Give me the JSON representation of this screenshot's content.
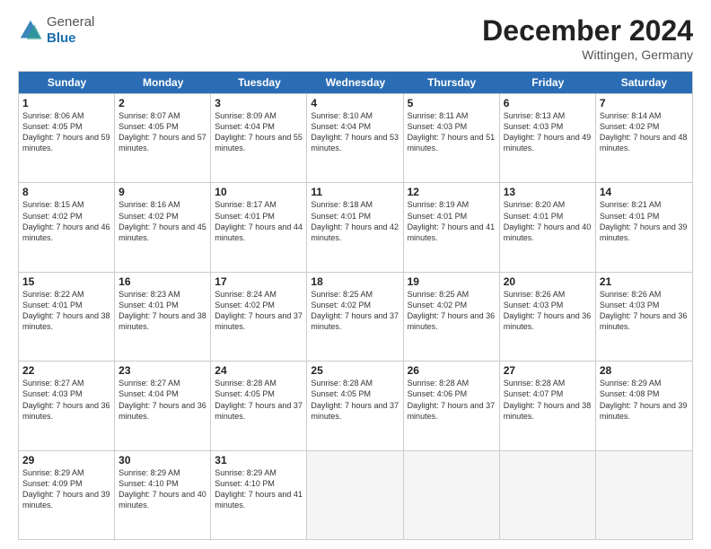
{
  "header": {
    "logo_general": "General",
    "logo_blue": "Blue",
    "month_year": "December 2024",
    "location": "Wittingen, Germany"
  },
  "weekdays": [
    "Sunday",
    "Monday",
    "Tuesday",
    "Wednesday",
    "Thursday",
    "Friday",
    "Saturday"
  ],
  "rows": [
    [
      {
        "day": "1",
        "sunrise": "Sunrise: 8:06 AM",
        "sunset": "Sunset: 4:05 PM",
        "daylight": "Daylight: 7 hours and 59 minutes."
      },
      {
        "day": "2",
        "sunrise": "Sunrise: 8:07 AM",
        "sunset": "Sunset: 4:05 PM",
        "daylight": "Daylight: 7 hours and 57 minutes."
      },
      {
        "day": "3",
        "sunrise": "Sunrise: 8:09 AM",
        "sunset": "Sunset: 4:04 PM",
        "daylight": "Daylight: 7 hours and 55 minutes."
      },
      {
        "day": "4",
        "sunrise": "Sunrise: 8:10 AM",
        "sunset": "Sunset: 4:04 PM",
        "daylight": "Daylight: 7 hours and 53 minutes."
      },
      {
        "day": "5",
        "sunrise": "Sunrise: 8:11 AM",
        "sunset": "Sunset: 4:03 PM",
        "daylight": "Daylight: 7 hours and 51 minutes."
      },
      {
        "day": "6",
        "sunrise": "Sunrise: 8:13 AM",
        "sunset": "Sunset: 4:03 PM",
        "daylight": "Daylight: 7 hours and 49 minutes."
      },
      {
        "day": "7",
        "sunrise": "Sunrise: 8:14 AM",
        "sunset": "Sunset: 4:02 PM",
        "daylight": "Daylight: 7 hours and 48 minutes."
      }
    ],
    [
      {
        "day": "8",
        "sunrise": "Sunrise: 8:15 AM",
        "sunset": "Sunset: 4:02 PM",
        "daylight": "Daylight: 7 hours and 46 minutes."
      },
      {
        "day": "9",
        "sunrise": "Sunrise: 8:16 AM",
        "sunset": "Sunset: 4:02 PM",
        "daylight": "Daylight: 7 hours and 45 minutes."
      },
      {
        "day": "10",
        "sunrise": "Sunrise: 8:17 AM",
        "sunset": "Sunset: 4:01 PM",
        "daylight": "Daylight: 7 hours and 44 minutes."
      },
      {
        "day": "11",
        "sunrise": "Sunrise: 8:18 AM",
        "sunset": "Sunset: 4:01 PM",
        "daylight": "Daylight: 7 hours and 42 minutes."
      },
      {
        "day": "12",
        "sunrise": "Sunrise: 8:19 AM",
        "sunset": "Sunset: 4:01 PM",
        "daylight": "Daylight: 7 hours and 41 minutes."
      },
      {
        "day": "13",
        "sunrise": "Sunrise: 8:20 AM",
        "sunset": "Sunset: 4:01 PM",
        "daylight": "Daylight: 7 hours and 40 minutes."
      },
      {
        "day": "14",
        "sunrise": "Sunrise: 8:21 AM",
        "sunset": "Sunset: 4:01 PM",
        "daylight": "Daylight: 7 hours and 39 minutes."
      }
    ],
    [
      {
        "day": "15",
        "sunrise": "Sunrise: 8:22 AM",
        "sunset": "Sunset: 4:01 PM",
        "daylight": "Daylight: 7 hours and 38 minutes."
      },
      {
        "day": "16",
        "sunrise": "Sunrise: 8:23 AM",
        "sunset": "Sunset: 4:01 PM",
        "daylight": "Daylight: 7 hours and 38 minutes."
      },
      {
        "day": "17",
        "sunrise": "Sunrise: 8:24 AM",
        "sunset": "Sunset: 4:02 PM",
        "daylight": "Daylight: 7 hours and 37 minutes."
      },
      {
        "day": "18",
        "sunrise": "Sunrise: 8:25 AM",
        "sunset": "Sunset: 4:02 PM",
        "daylight": "Daylight: 7 hours and 37 minutes."
      },
      {
        "day": "19",
        "sunrise": "Sunrise: 8:25 AM",
        "sunset": "Sunset: 4:02 PM",
        "daylight": "Daylight: 7 hours and 36 minutes."
      },
      {
        "day": "20",
        "sunrise": "Sunrise: 8:26 AM",
        "sunset": "Sunset: 4:03 PM",
        "daylight": "Daylight: 7 hours and 36 minutes."
      },
      {
        "day": "21",
        "sunrise": "Sunrise: 8:26 AM",
        "sunset": "Sunset: 4:03 PM",
        "daylight": "Daylight: 7 hours and 36 minutes."
      }
    ],
    [
      {
        "day": "22",
        "sunrise": "Sunrise: 8:27 AM",
        "sunset": "Sunset: 4:03 PM",
        "daylight": "Daylight: 7 hours and 36 minutes."
      },
      {
        "day": "23",
        "sunrise": "Sunrise: 8:27 AM",
        "sunset": "Sunset: 4:04 PM",
        "daylight": "Daylight: 7 hours and 36 minutes."
      },
      {
        "day": "24",
        "sunrise": "Sunrise: 8:28 AM",
        "sunset": "Sunset: 4:05 PM",
        "daylight": "Daylight: 7 hours and 37 minutes."
      },
      {
        "day": "25",
        "sunrise": "Sunrise: 8:28 AM",
        "sunset": "Sunset: 4:05 PM",
        "daylight": "Daylight: 7 hours and 37 minutes."
      },
      {
        "day": "26",
        "sunrise": "Sunrise: 8:28 AM",
        "sunset": "Sunset: 4:06 PM",
        "daylight": "Daylight: 7 hours and 37 minutes."
      },
      {
        "day": "27",
        "sunrise": "Sunrise: 8:28 AM",
        "sunset": "Sunset: 4:07 PM",
        "daylight": "Daylight: 7 hours and 38 minutes."
      },
      {
        "day": "28",
        "sunrise": "Sunrise: 8:29 AM",
        "sunset": "Sunset: 4:08 PM",
        "daylight": "Daylight: 7 hours and 39 minutes."
      }
    ],
    [
      {
        "day": "29",
        "sunrise": "Sunrise: 8:29 AM",
        "sunset": "Sunset: 4:09 PM",
        "daylight": "Daylight: 7 hours and 39 minutes."
      },
      {
        "day": "30",
        "sunrise": "Sunrise: 8:29 AM",
        "sunset": "Sunset: 4:10 PM",
        "daylight": "Daylight: 7 hours and 40 minutes."
      },
      {
        "day": "31",
        "sunrise": "Sunrise: 8:29 AM",
        "sunset": "Sunset: 4:10 PM",
        "daylight": "Daylight: 7 hours and 41 minutes."
      },
      null,
      null,
      null,
      null
    ]
  ]
}
